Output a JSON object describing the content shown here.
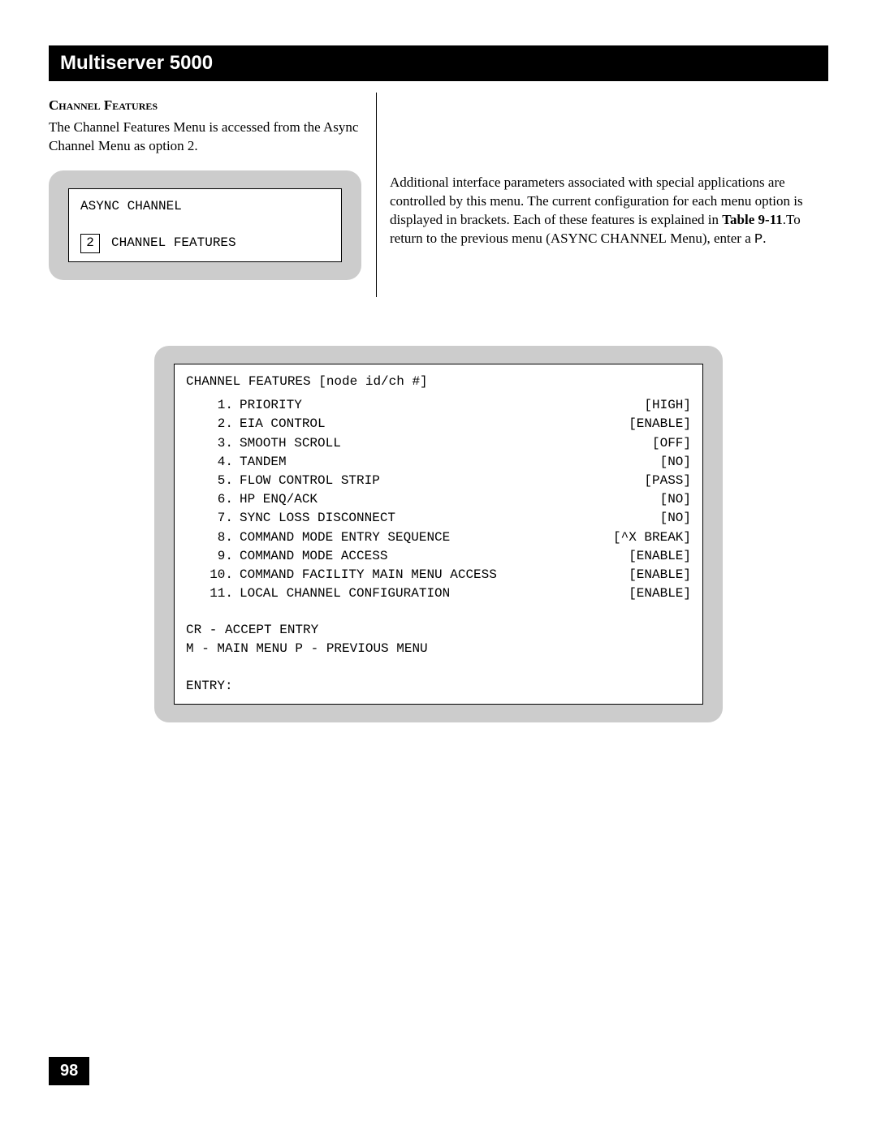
{
  "title": "Multiserver 5000",
  "section_heading": "Channel Features",
  "intro_left": "The Channel Features Menu is accessed from the Async Channel Menu as option 2.",
  "async_panel": {
    "header": "ASYNC CHANNEL",
    "option_num": "2",
    "option_label": "CHANNEL FEATURES"
  },
  "intro_right_1": "Additional interface parameters associated with special applications are controlled by this menu. The current configuration for each menu option is displayed in brackets. Each of these features is explained in ",
  "intro_right_ref": "Table 9-11",
  "intro_right_2": ".To return to the previous menu (",
  "intro_right_code": "ASYNC CHANNEL",
  "intro_right_3": "  Menu), enter a ",
  "intro_right_p": "P",
  "intro_right_4": ".",
  "features_panel": {
    "header": "CHANNEL FEATURES [node id/ch #]",
    "items": [
      {
        "n": "1.",
        "label": "PRIORITY",
        "val": "[HIGH]"
      },
      {
        "n": "2.",
        "label": "EIA CONTROL",
        "val": "[ENABLE]"
      },
      {
        "n": "3.",
        "label": "SMOOTH SCROLL",
        "val": "[OFF]"
      },
      {
        "n": "4.",
        "label": "TANDEM",
        "val": "[NO]"
      },
      {
        "n": "5.",
        "label": "FLOW CONTROL STRIP",
        "val": "[PASS]"
      },
      {
        "n": "6.",
        "label": "HP ENQ/ACK",
        "val": "[NO]"
      },
      {
        "n": "7.",
        "label": "SYNC LOSS DISCONNECT",
        "val": "[NO]"
      },
      {
        "n": "8.",
        "label": "COMMAND MODE ENTRY SEQUENCE",
        "val": "[^X BREAK]"
      },
      {
        "n": "9.",
        "label": "COMMAND MODE ACCESS",
        "val": "[ENABLE]"
      },
      {
        "n": "10.",
        "label": "COMMAND FACILITY MAIN MENU ACCESS",
        "val": "[ENABLE]"
      },
      {
        "n": "11.",
        "label": "LOCAL CHANNEL CONFIGURATION",
        "val": "[ENABLE]"
      }
    ],
    "footer1": "CR - ACCEPT ENTRY",
    "footer2": "M  - MAIN MENU  P - PREVIOUS MENU",
    "entry": "ENTRY:"
  },
  "page_number": "98"
}
